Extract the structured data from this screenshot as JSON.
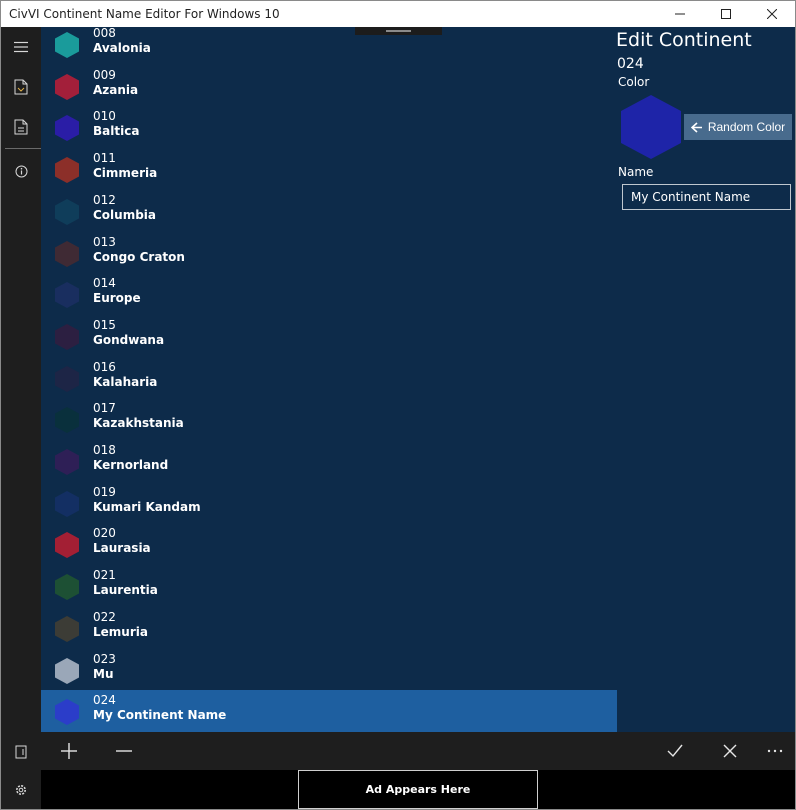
{
  "window": {
    "title": "CivVI Continent Name Editor For Windows 10"
  },
  "rail": {
    "items": [
      {
        "name": "menu",
        "icon": "hamburger-icon"
      },
      {
        "name": "open-file",
        "icon": "open-file-icon"
      },
      {
        "name": "save-file",
        "icon": "save-file-icon"
      },
      {
        "name": "about",
        "icon": "info-icon"
      }
    ],
    "bottom": [
      {
        "name": "export",
        "icon": "export-icon"
      },
      {
        "name": "settings",
        "icon": "gear-icon"
      }
    ]
  },
  "continents": [
    {
      "num": "008",
      "name": "Avalonia",
      "color": "#1a9b9b"
    },
    {
      "num": "009",
      "name": "Azania",
      "color": "#a31f3a"
    },
    {
      "num": "010",
      "name": "Baltica",
      "color": "#2a1da6"
    },
    {
      "num": "011",
      "name": "Cimmeria",
      "color": "#8c2f29"
    },
    {
      "num": "012",
      "name": "Columbia",
      "color": "#0f3d5a"
    },
    {
      "num": "013",
      "name": "Congo Craton",
      "color": "#3f2a34"
    },
    {
      "num": "014",
      "name": "Europe",
      "color": "#192e5f"
    },
    {
      "num": "015",
      "name": "Gondwana",
      "color": "#2c1f41"
    },
    {
      "num": "016",
      "name": "Kalaharia",
      "color": "#1d2546"
    },
    {
      "num": "017",
      "name": "Kazakhstania",
      "color": "#09303c"
    },
    {
      "num": "018",
      "name": "Kernorland",
      "color": "#2e1f56"
    },
    {
      "num": "019",
      "name": "Kumari Kandam",
      "color": "#132f63"
    },
    {
      "num": "020",
      "name": "Laurasia",
      "color": "#a31f34"
    },
    {
      "num": "021",
      "name": "Laurentia",
      "color": "#1d5034"
    },
    {
      "num": "022",
      "name": "Lemuria",
      "color": "#3c3c36"
    },
    {
      "num": "023",
      "name": "Mu",
      "color": "#9aa7b8"
    },
    {
      "num": "024",
      "name": "My Continent Name",
      "color": "#2b3dc9"
    }
  ],
  "selected_index": 16,
  "edit": {
    "title": "Edit Continent",
    "number": "024",
    "color_label": "Color",
    "color": "#1e24a8",
    "random_button": "Random Color",
    "name_label": "Name",
    "name_value": "My Continent Name"
  },
  "commandbar": {
    "left": [
      {
        "name": "add",
        "icon": "plus-icon"
      },
      {
        "name": "remove",
        "icon": "minus-icon"
      }
    ],
    "right": [
      {
        "name": "accept",
        "icon": "check-icon"
      },
      {
        "name": "cancel",
        "icon": "close-icon"
      },
      {
        "name": "more",
        "icon": "more-icon"
      }
    ]
  },
  "ad": {
    "text": "Ad Appears Here"
  }
}
